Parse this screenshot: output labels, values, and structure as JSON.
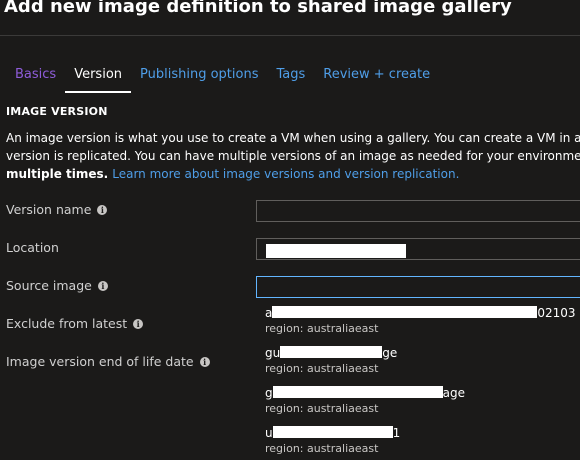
{
  "page": {
    "title": "Add new image definition to shared image gallery"
  },
  "tabs": [
    {
      "label": "Basics"
    },
    {
      "label": "Version"
    },
    {
      "label": "Publishing options"
    },
    {
      "label": "Tags"
    },
    {
      "label": "Review + create"
    }
  ],
  "section": {
    "heading": "IMAGE VERSION",
    "description_lines": [
      "An image version is what you use to create a VM when using a gallery. You can create a VM in any re",
      "version is replicated. You can have multiple versions of an image as needed for your environment. Im",
      "multiple times."
    ],
    "learn_more": "Learn more about image versions and version replication."
  },
  "fields": {
    "version_name": {
      "label": "Version name",
      "value": ""
    },
    "location": {
      "label": "Location"
    },
    "source_image": {
      "label": "Source image",
      "value": ""
    },
    "exclude_from_latest": {
      "label": "Exclude from latest"
    },
    "end_of_life": {
      "label": "Image version end of life date"
    }
  },
  "source_image_options": [
    {
      "name_prefix": "a",
      "name_suffix": "02103",
      "region": "region: australiaeast"
    },
    {
      "name_prefix": "gu",
      "name_suffix": "ge",
      "region": "region: australiaeast"
    },
    {
      "name_prefix": "g",
      "name_suffix": "age",
      "region": "region: australiaeast"
    },
    {
      "name_prefix": "u",
      "name_suffix": "1",
      "region": "region: australiaeast"
    }
  ],
  "icons": {
    "info": "info-icon"
  },
  "colors": {
    "background": "#1b1a19",
    "link": "#4f9ee8",
    "visited_tab": "#8e5cd9",
    "focus_border": "#62b5ff"
  }
}
